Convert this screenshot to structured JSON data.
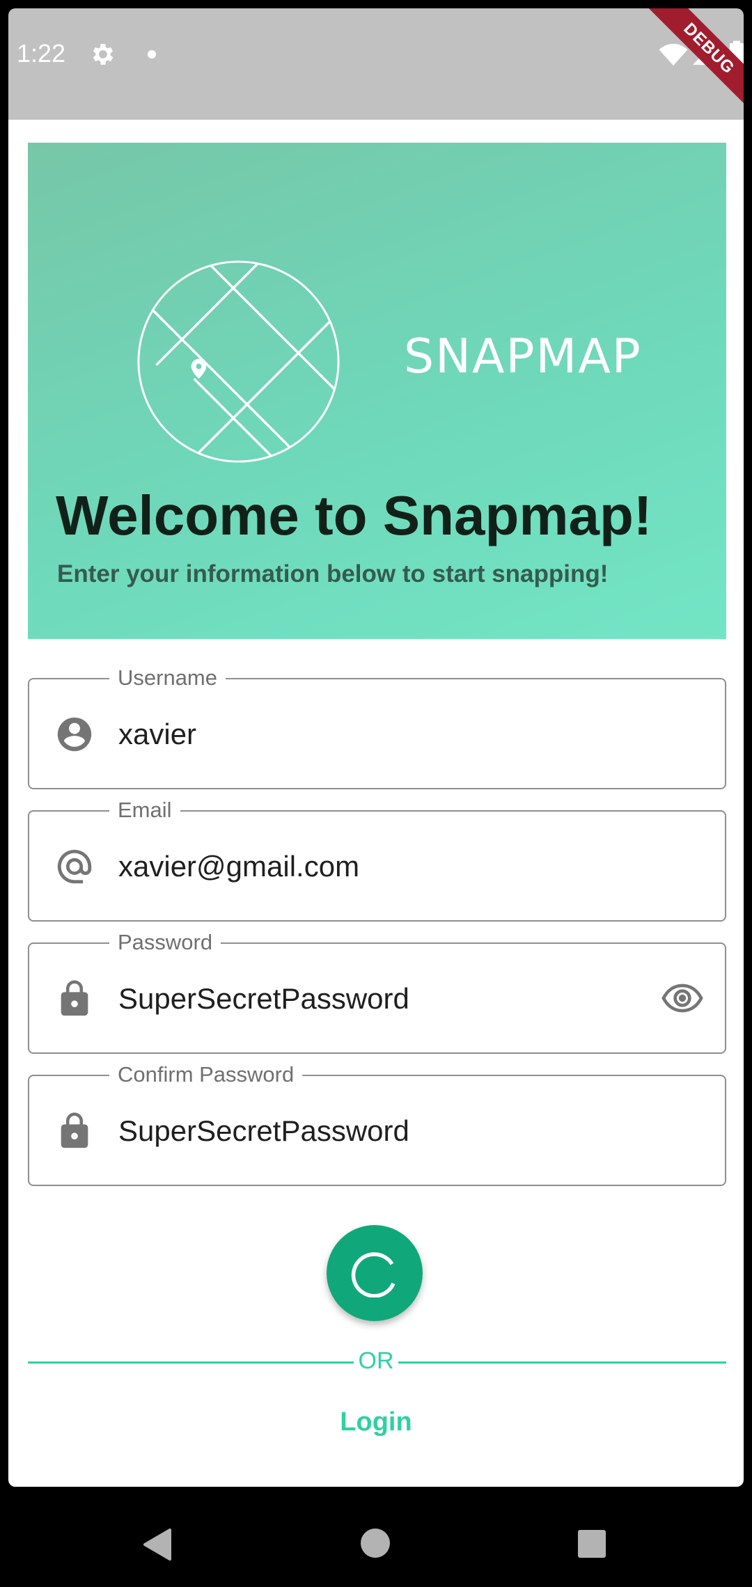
{
  "status_bar": {
    "time": "1:22",
    "debug_label": "DEBUG"
  },
  "hero": {
    "brand": "SNAPMAP",
    "title": "Welcome to Snapmap!",
    "subtitle": "Enter your information below to start snapping!",
    "gradient_colors": [
      "#76c7a8",
      "#72e5c5"
    ]
  },
  "form": {
    "username": {
      "label": "Username",
      "value": "xavier",
      "icon": "account-circle-icon"
    },
    "email": {
      "label": "Email",
      "value": "xavier@gmail.com",
      "icon": "at-sign-icon"
    },
    "password": {
      "label": "Password",
      "value": "SuperSecretPassword",
      "icon": "lock-icon",
      "toggle_icon": "eye-icon"
    },
    "confirm_password": {
      "label": "Confirm Password",
      "value": "SuperSecretPassword",
      "icon": "lock-icon"
    }
  },
  "submit": {
    "state": "loading",
    "color": "#10a87a"
  },
  "divider": {
    "text": "OR"
  },
  "login": {
    "label": "Login"
  },
  "accent_color": "#2fd0a4"
}
